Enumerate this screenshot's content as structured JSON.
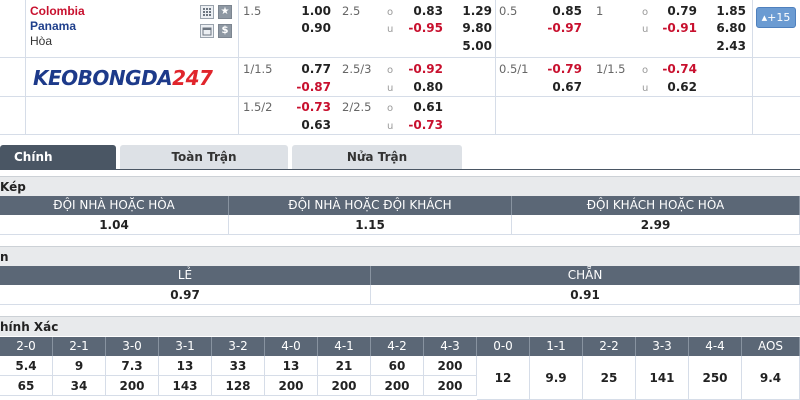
{
  "match": {
    "home": "Colombia",
    "away": "Panama",
    "draw": "Hòa",
    "more_label": "+15",
    "logo_text_a": "KEOBONGDA",
    "logo_text_b": "247",
    "icons": [
      "grid-icon",
      "star-icon",
      "calendar-icon",
      "dollar-icon"
    ]
  },
  "odds": {
    "row1": {
      "hcp1": "1.5",
      "h1_home": "1.00",
      "h1_away": "0.90",
      "ou1": "2.5",
      "o1_over": "0.83",
      "o1_under": "-0.95",
      "x12_1": "1.29",
      "x12_2": "9.80",
      "x12_3": "5.00",
      "hcp2": "0.5",
      "h2_home": "0.85",
      "h2_away": "-0.97",
      "ou2": "1",
      "o2_over": "0.79",
      "o2_under": "-0.91",
      "y12_1": "1.85",
      "y12_2": "6.80",
      "y12_3": "2.43",
      "o_label": "o",
      "u_label": "u"
    },
    "row2": {
      "hcp1": "1/1.5",
      "h1_home": "0.77",
      "h1_away": "-0.87",
      "ou1": "2.5/3",
      "o1_over": "-0.92",
      "o1_under": "0.80",
      "hcp2": "0.5/1",
      "h2_home": "-0.79",
      "h2_away": "0.67",
      "ou2": "1/1.5",
      "o2_over": "-0.74",
      "o2_under": "0.62"
    },
    "row3": {
      "hcp1": "1.5/2",
      "h1_home": "-0.73",
      "h1_away": "0.63",
      "ou1": "2/2.5",
      "o1_over": "0.61",
      "o1_under": "-0.73"
    }
  },
  "tabs": [
    {
      "label": "Chính",
      "active": true
    },
    {
      "label": "Toàn Trận",
      "active": false
    },
    {
      "label": "Nửa Trận",
      "active": false
    }
  ],
  "double_chance": {
    "title": "Kép",
    "headers": [
      "ĐỘI NHÀ HOẶC HÒA",
      "ĐỘI NHÀ HOẶC ĐỘI KHÁCH",
      "ĐỘI KHÁCH HOẶC HÒA"
    ],
    "values": [
      "1.04",
      "1.15",
      "2.99"
    ]
  },
  "odd_even": {
    "title": "n",
    "headers": [
      "LẺ",
      "CHẴN"
    ],
    "values": [
      "0.97",
      "0.91"
    ]
  },
  "correct_score": {
    "title": "hính Xác",
    "headers": [
      "2-0",
      "2-1",
      "3-0",
      "3-1",
      "3-2",
      "4-0",
      "4-1",
      "4-2",
      "4-3",
      "0-0",
      "1-1",
      "2-2",
      "3-3",
      "4-4",
      "AOS"
    ],
    "row1": [
      "5.4",
      "9",
      "7.3",
      "13",
      "33",
      "13",
      "21",
      "60",
      "200"
    ],
    "row2": [
      "65",
      "34",
      "200",
      "143",
      "128",
      "200",
      "200",
      "200",
      "200"
    ],
    "draws": [
      "12",
      "9.9",
      "25",
      "141",
      "250",
      "9.4"
    ]
  }
}
